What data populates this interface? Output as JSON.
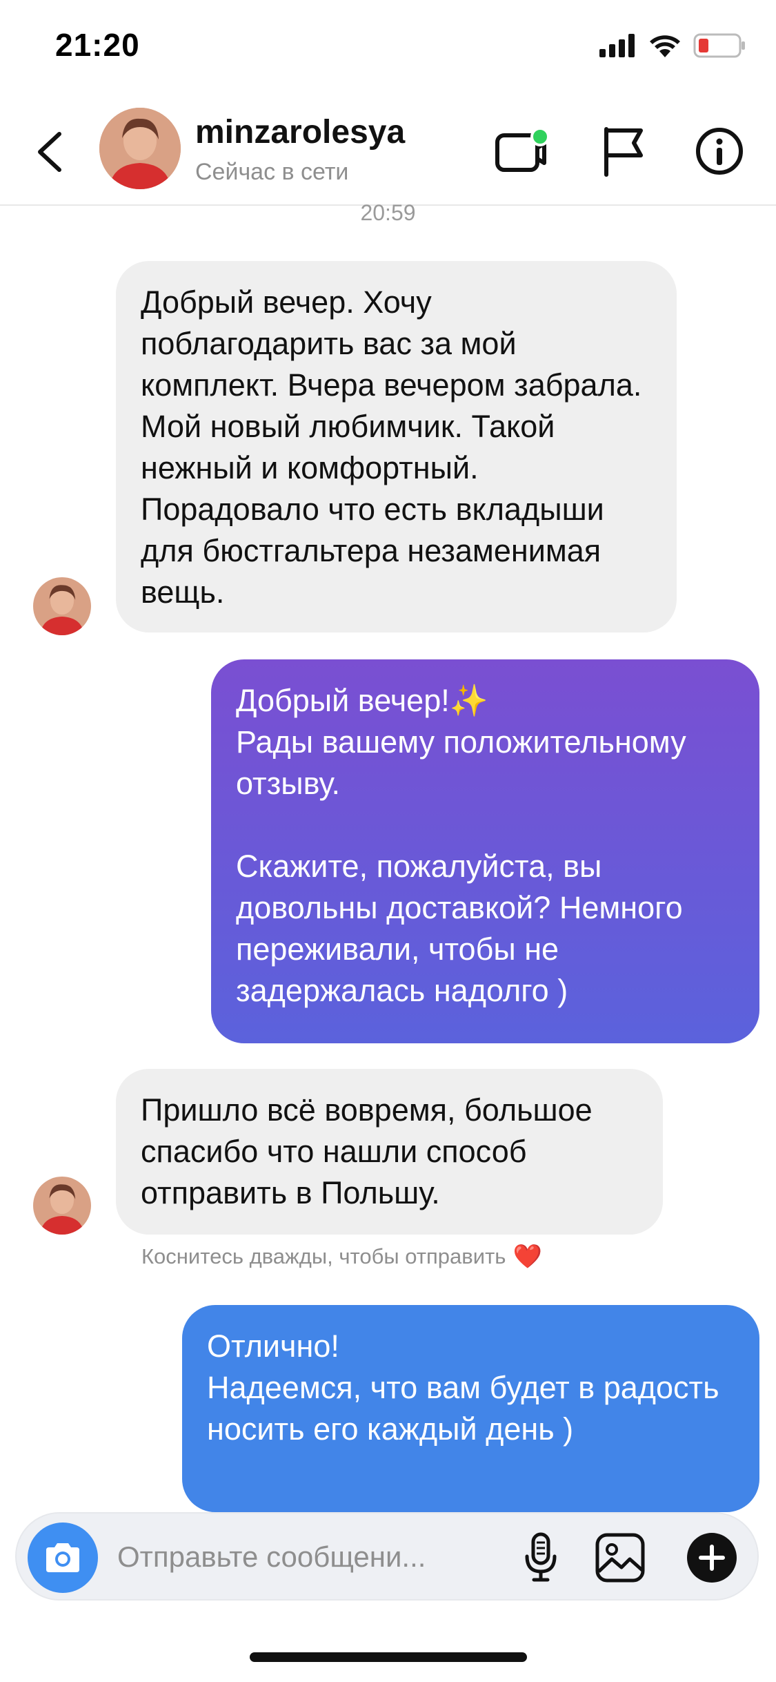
{
  "status_bar": {
    "time": "21:20",
    "icons": [
      "cellular-signal-icon",
      "wifi-icon",
      "battery-low-icon"
    ]
  },
  "header": {
    "username": "minzarolesya",
    "presence": "Сейчас в сети",
    "actions": [
      "video-call-icon",
      "flag-icon",
      "info-icon"
    ]
  },
  "chat": {
    "timestamp": "20:59",
    "messages": [
      {
        "from": "them",
        "text": "Добрый вечер. Хочу поблагодарить вас за мой комплект. Вчера вечером забрала. Мой новый любимчик. Такой нежный и комфортный. Порадовало что есть вкладыши для бюстгальтера незаменимая вещь."
      },
      {
        "from": "me",
        "text": "Добрый вечер!✨\nРады вашему положительному отзыву.\n\nСкажите, пожалуйста, вы довольны доставкой? Немного переживали, чтобы не задержалась надолго )"
      },
      {
        "from": "them",
        "text": "Пришло всё вовремя, большое спасибо что нашли способ отправить в Польшу."
      },
      {
        "from": "me",
        "text": "Отлично!\nНадеемся, что вам будет в радость носить его каждый день )"
      }
    ],
    "double_tap_hint": "Коснитесь дважды, чтобы отправить",
    "hint_emoji": "❤️"
  },
  "composer": {
    "placeholder": "Отправьте сообщени...",
    "icons": [
      "camera-icon",
      "microphone-icon",
      "gallery-icon",
      "plus-icon"
    ]
  },
  "colors": {
    "incoming_bubble": "#efefef",
    "outgoing_gradient_top": "#7a4fd2",
    "outgoing_gradient_bottom": "#5b62dc",
    "outgoing_blue": "#4285e8",
    "camera_button": "#3f8ff2",
    "online_dot": "#2fd15c"
  }
}
